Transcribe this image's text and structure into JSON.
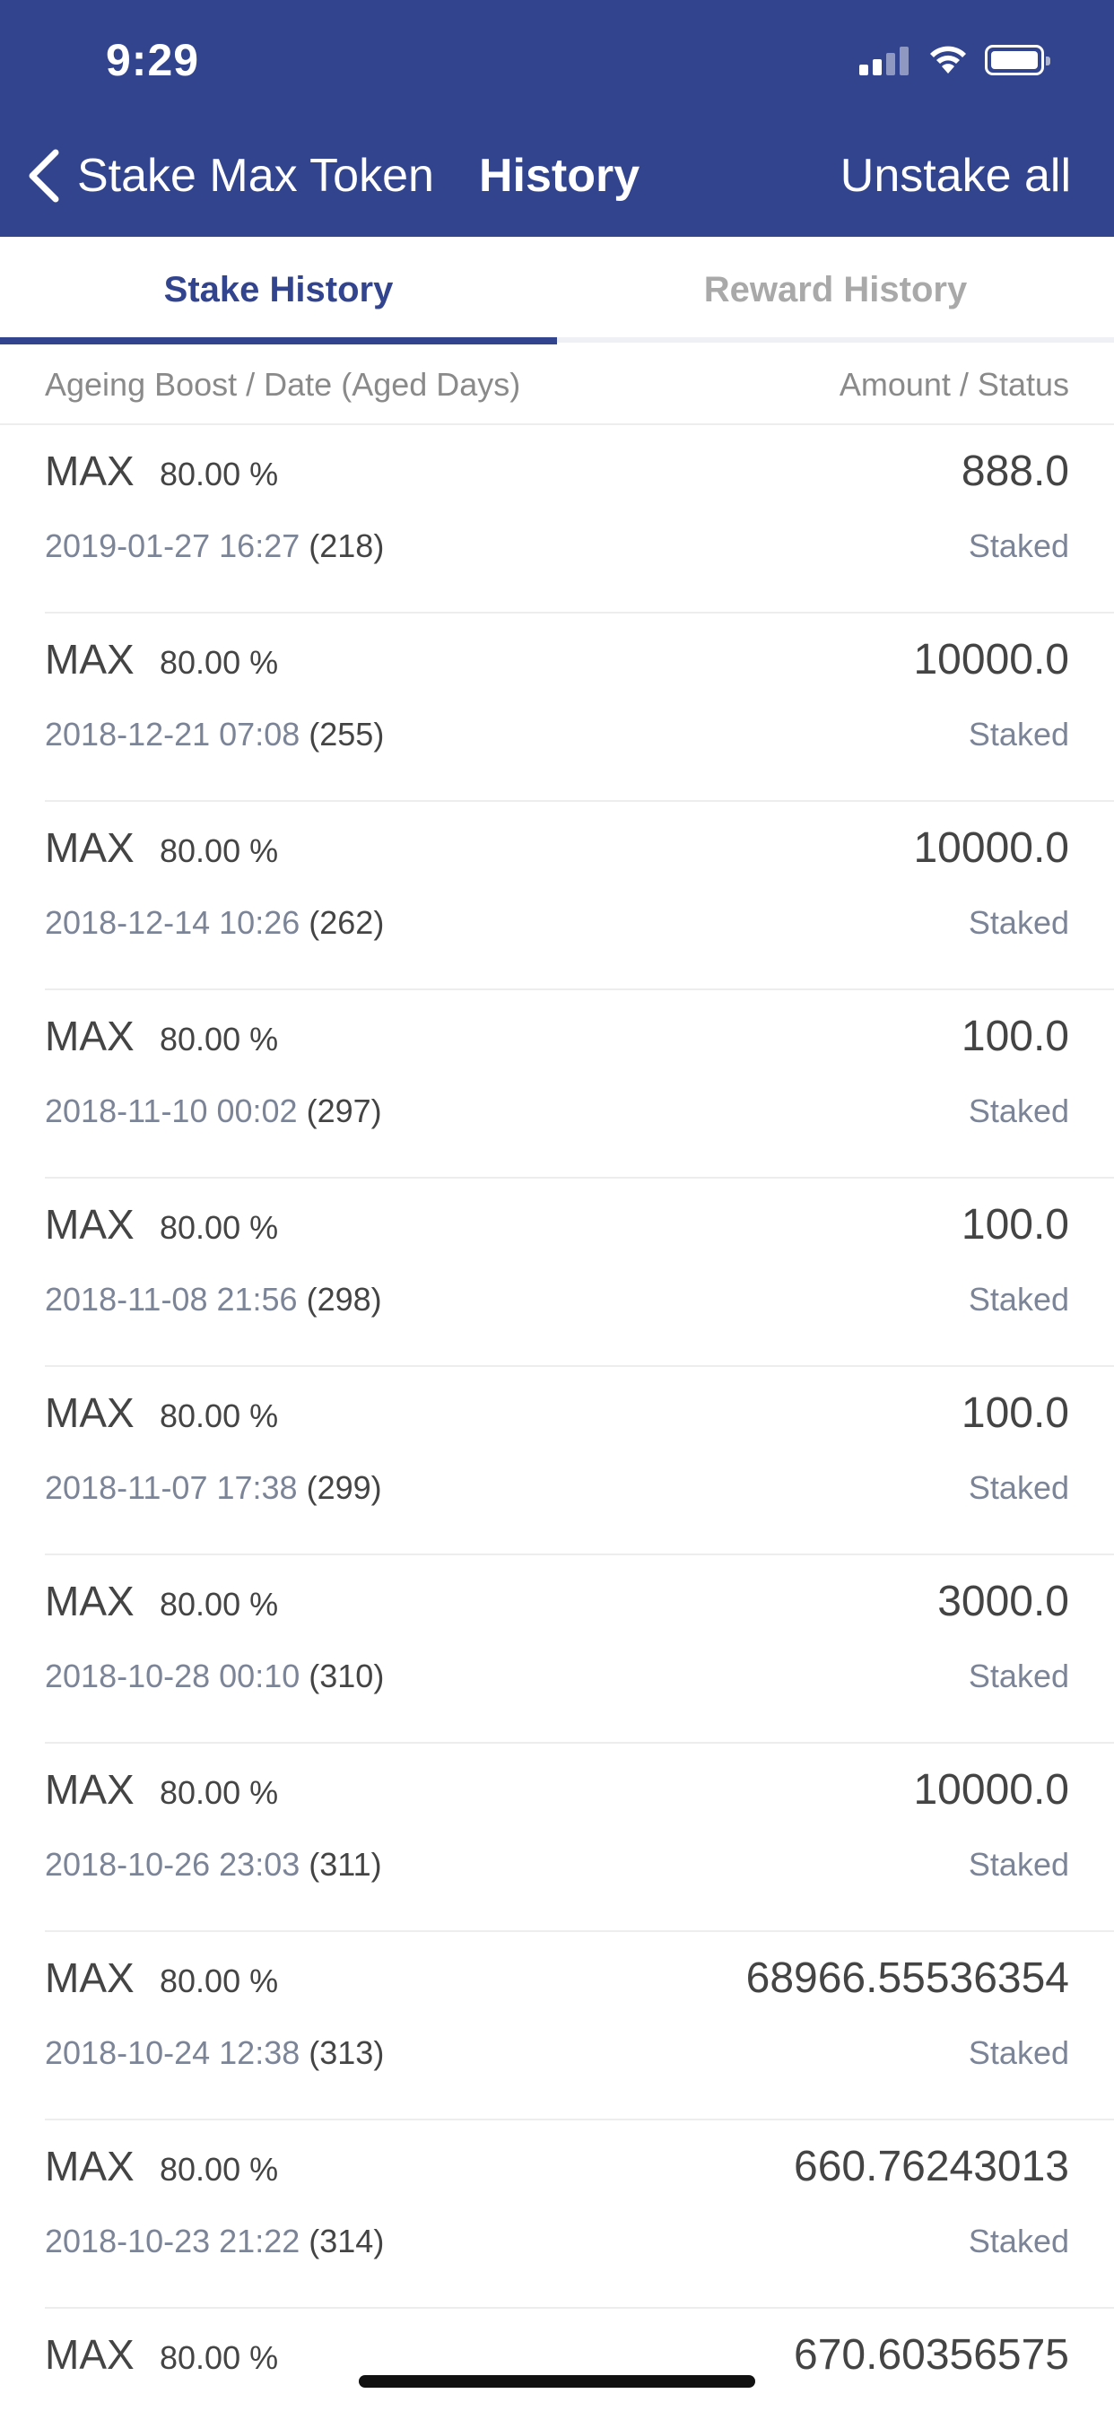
{
  "status_bar": {
    "time": "9:29"
  },
  "nav": {
    "back_label": "Stake Max Token",
    "title": "History",
    "action_label": "Unstake all"
  },
  "tabs": [
    {
      "label": "Stake History",
      "active": true
    },
    {
      "label": "Reward History",
      "active": false
    }
  ],
  "columns": {
    "left": "Ageing Boost / Date (Aged Days)",
    "right": "Amount / Status"
  },
  "accent_color": "#33448f",
  "rows": [
    {
      "token": "MAX",
      "boost": "80.00 %",
      "amount": "888.0",
      "date": "2019-01-27 16:27",
      "days": "(218)",
      "status": "Staked"
    },
    {
      "token": "MAX",
      "boost": "80.00 %",
      "amount": "10000.0",
      "date": "2018-12-21 07:08",
      "days": "(255)",
      "status": "Staked"
    },
    {
      "token": "MAX",
      "boost": "80.00 %",
      "amount": "10000.0",
      "date": "2018-12-14 10:26",
      "days": "(262)",
      "status": "Staked"
    },
    {
      "token": "MAX",
      "boost": "80.00 %",
      "amount": "100.0",
      "date": "2018-11-10 00:02",
      "days": "(297)",
      "status": "Staked"
    },
    {
      "token": "MAX",
      "boost": "80.00 %",
      "amount": "100.0",
      "date": "2018-11-08 21:56",
      "days": "(298)",
      "status": "Staked"
    },
    {
      "token": "MAX",
      "boost": "80.00 %",
      "amount": "100.0",
      "date": "2018-11-07 17:38",
      "days": "(299)",
      "status": "Staked"
    },
    {
      "token": "MAX",
      "boost": "80.00 %",
      "amount": "3000.0",
      "date": "2018-10-28 00:10",
      "days": "(310)",
      "status": "Staked"
    },
    {
      "token": "MAX",
      "boost": "80.00 %",
      "amount": "10000.0",
      "date": "2018-10-26 23:03",
      "days": "(311)",
      "status": "Staked"
    },
    {
      "token": "MAX",
      "boost": "80.00 %",
      "amount": "68966.55536354",
      "date": "2018-10-24 12:38",
      "days": "(313)",
      "status": "Staked"
    },
    {
      "token": "MAX",
      "boost": "80.00 %",
      "amount": "660.76243013",
      "date": "2018-10-23 21:22",
      "days": "(314)",
      "status": "Staked"
    },
    {
      "token": "MAX",
      "boost": "80.00 %",
      "amount": "670.60356575",
      "date": "",
      "days": "",
      "status": ""
    }
  ]
}
